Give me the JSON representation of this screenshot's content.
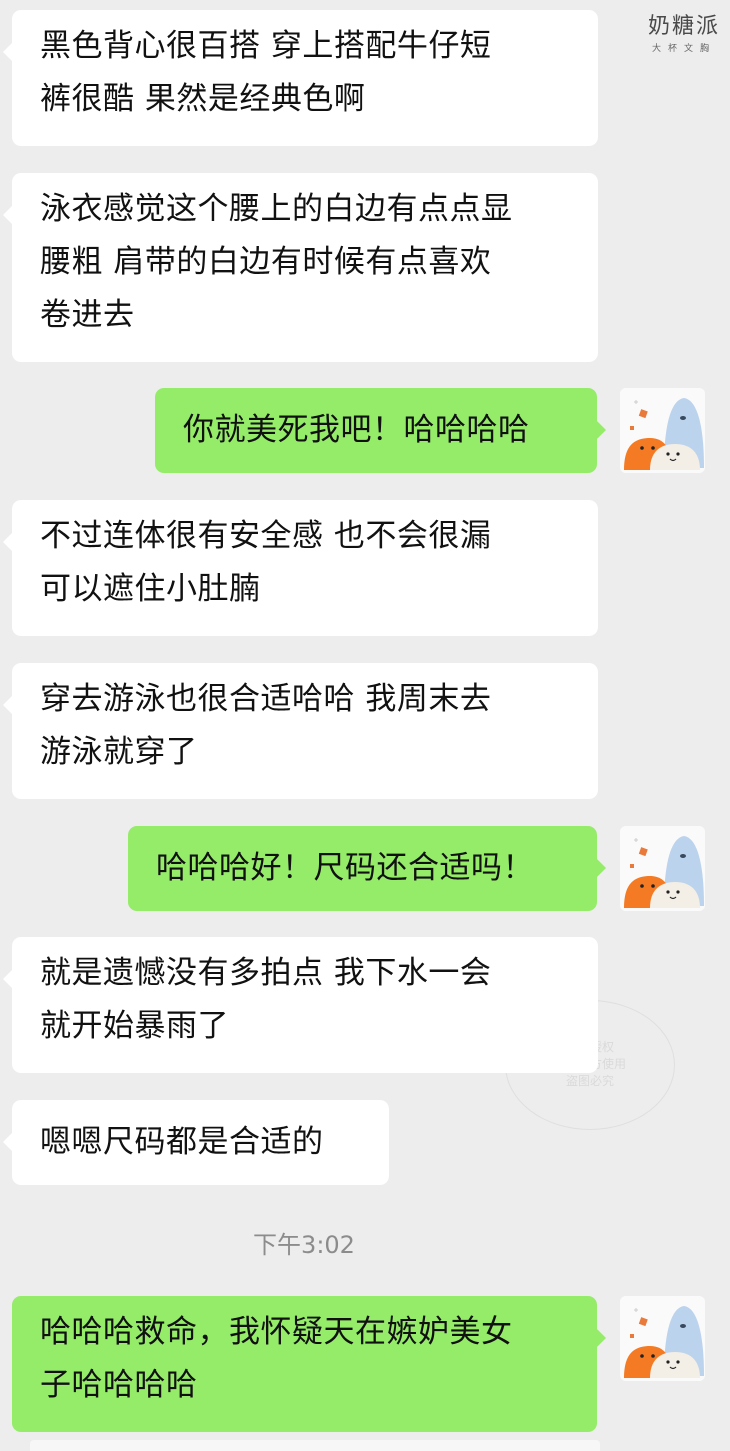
{
  "watermark": {
    "name": "奶糖派",
    "sub": "大杯文胸"
  },
  "stamp": {
    "line1": "用户授权",
    "line2": "仅供官方使用",
    "line3": "盗图必究"
  },
  "messages": [
    {
      "id": "m1",
      "side": "in",
      "lines": [
        "黑色背心很百搭 穿上搭配牛仔短",
        "裤很酷 果然是经典色啊"
      ]
    },
    {
      "id": "m2",
      "side": "in",
      "lines": [
        "泳衣感觉这个腰上的白边有点点显",
        "腰粗  肩带的白边有时候有点喜欢",
        "卷进去"
      ]
    },
    {
      "id": "m3",
      "side": "out",
      "lines": [
        "你就美死我吧！哈哈哈哈"
      ]
    },
    {
      "id": "m4",
      "side": "in",
      "lines": [
        "不过连体很有安全感  也不会很漏",
        "可以遮住小肚腩"
      ]
    },
    {
      "id": "m5",
      "side": "in",
      "lines": [
        "穿去游泳也很合适哈哈 我周末去",
        "游泳就穿了"
      ]
    },
    {
      "id": "m6",
      "side": "out",
      "lines": [
        "哈哈哈好！尺码还合适吗！"
      ]
    },
    {
      "id": "m7",
      "side": "in",
      "lines": [
        "就是遗憾没有多拍点 我下水一会",
        "就开始暴雨了"
      ]
    },
    {
      "id": "m8",
      "side": "in",
      "lines": [
        "嗯嗯尺码都是合适的"
      ]
    },
    {
      "id": "m9",
      "side": "out",
      "lines": [
        "哈哈哈救命，我怀疑天在嫉妒美女",
        "子哈哈哈哈"
      ]
    }
  ],
  "timestamp": "下午3:02",
  "colors": {
    "background": "#ededed",
    "incoming_bubble": "#ffffff",
    "outgoing_bubble": "#95ec69",
    "timestamp_text": "#8c8c8c"
  },
  "avatar": {
    "icon": "cartoon-characters-avatar-icon"
  }
}
